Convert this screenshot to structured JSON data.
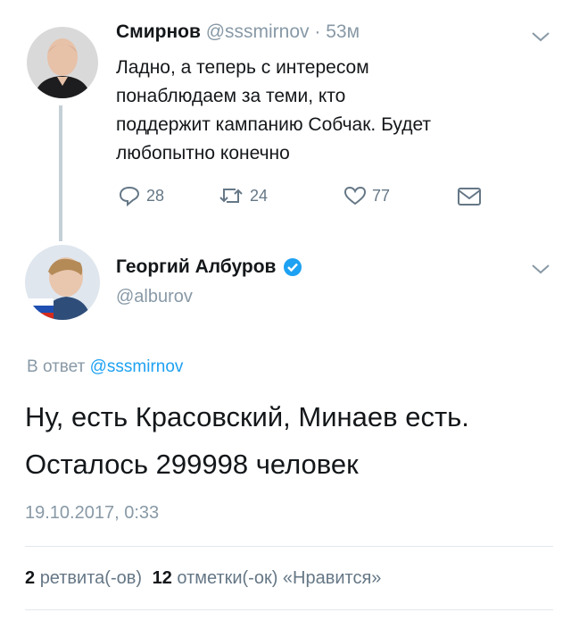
{
  "reply_tweet": {
    "author_name": "Смирнов",
    "handle": "@sssmirnov",
    "separator": "·",
    "time": "53м",
    "text_lines": [
      "Ладно, а теперь с интересом",
      "понаблюдаем за теми, кто",
      "поддержит кампанию Собчак. Будет",
      "любопытно конечно"
    ],
    "actions": {
      "replies": "28",
      "retweets": "24",
      "likes": "77"
    }
  },
  "main_tweet": {
    "author_name": "Георгий Албуров",
    "handle": "@alburov",
    "reply_prefix": "В ответ",
    "reply_to": "@sssmirnov",
    "text_lines": [
      "Ну, есть Красовский, Минаев есть.",
      "Осталось 299998 человек"
    ],
    "timestamp": "19.10.2017, 0:33",
    "retweet_count": "2",
    "retweet_label": "ретвита(-ов)",
    "like_count": "12",
    "like_label": "отметки(-ок) «Нравится»"
  },
  "colors": {
    "link": "#1da1f2",
    "muted": "#8899a6",
    "verified": "#1da1f2"
  },
  "icons": [
    "reply-icon",
    "retweet-icon",
    "like-icon",
    "direct-message-icon",
    "verified-badge-icon",
    "chevron-down-icon"
  ]
}
